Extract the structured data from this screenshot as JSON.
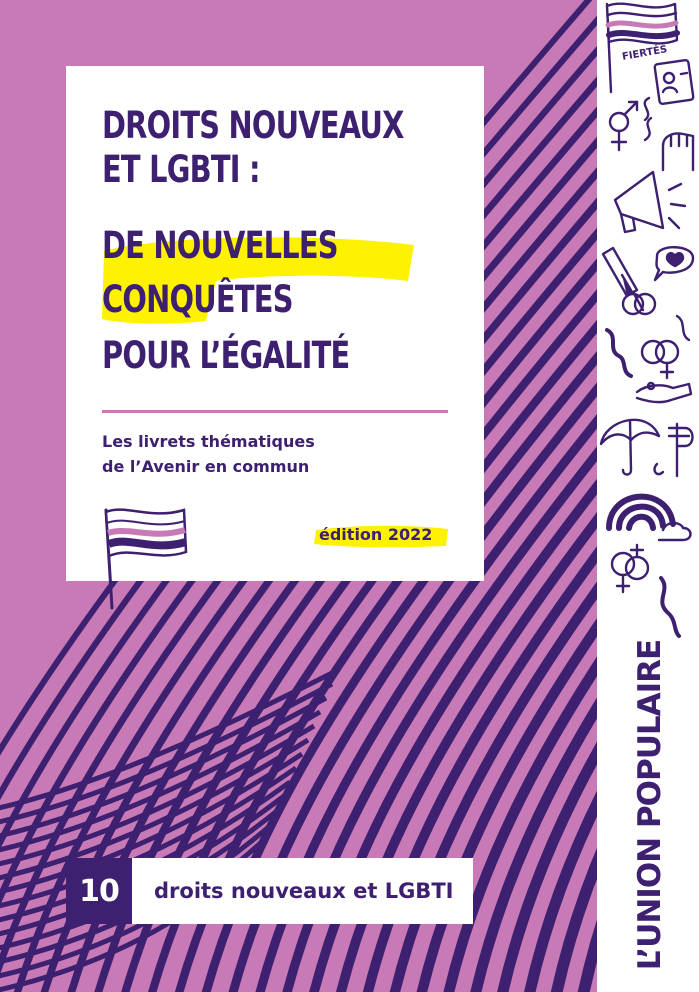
{
  "colors": {
    "pink": "#c77ab5",
    "purple": "#3d2070",
    "highlight_yellow": "#fff200",
    "white": "#ffffff"
  },
  "title": {
    "lines": [
      "DROITS NOUVEAUX",
      "ET LGBTI :",
      "DE NOUVELLES",
      "CONQUÊTES",
      "POUR L’ÉGALITÉ"
    ]
  },
  "subtitle": {
    "line1": "Les livrets thématiques",
    "line2": "de l’Avenir en commun"
  },
  "edition": "édition 2022",
  "sidebar": {
    "brand": "L’UNION POPULAIRE",
    "sticker_label": "FIERTÉS",
    "icons": [
      "pride-flag-icon",
      "id-card-icon",
      "gender-symbols-icon",
      "raised-fist-icon",
      "megaphone-icon",
      "syringe-icon",
      "heart-speech-bubble-icon",
      "rings-icon",
      "hand-icon",
      "umbrella-icon",
      "rainbow-icon",
      "interlocked-female-symbols-icon"
    ]
  },
  "collection": {
    "number": "10",
    "label": "droits nouveaux et LGBTI"
  }
}
